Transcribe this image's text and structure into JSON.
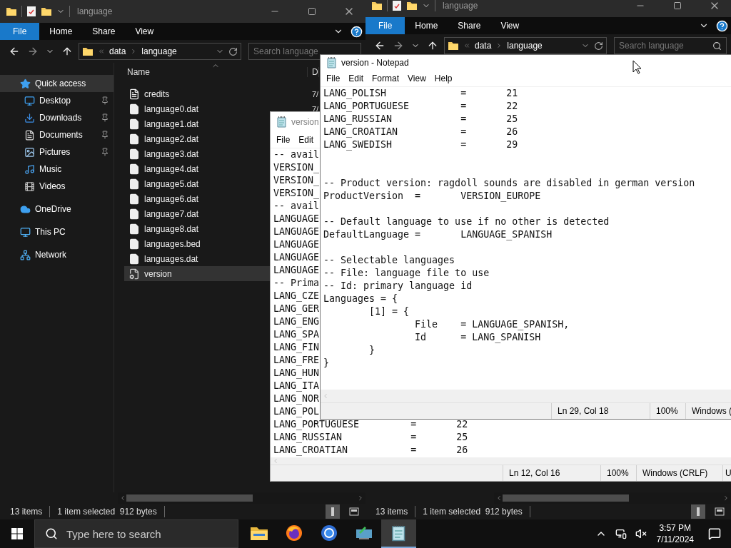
{
  "explorers": [
    {
      "title": "language",
      "ribbon_tabs": [
        {
          "label": "File",
          "selected": true
        },
        {
          "label": "Home",
          "selected": false
        },
        {
          "label": "Share",
          "selected": false
        },
        {
          "label": "View",
          "selected": false
        }
      ],
      "breadcrumb": [
        "data",
        "language"
      ],
      "search": {
        "placeholder": "Search language",
        "icon": false
      },
      "navigation": [
        {
          "label": "Quick access",
          "selected": true,
          "children": [
            {
              "label": "Desktop",
              "pinned": true,
              "selected": false
            },
            {
              "label": "Downloads",
              "pinned": true,
              "selected": false
            },
            {
              "label": "Documents",
              "pinned": true,
              "selected": false
            },
            {
              "label": "Pictures",
              "pinned": true,
              "selected": false
            },
            {
              "label": "Music",
              "pinned": false,
              "selected": false
            },
            {
              "label": "Videos",
              "pinned": false,
              "selected": false
            }
          ]
        },
        {
          "label": "OneDrive",
          "selected": false
        },
        {
          "label": "This PC",
          "selected": false
        },
        {
          "label": "Network",
          "selected": false
        }
      ],
      "columns": [
        "Name",
        "D"
      ],
      "files": [
        {
          "name": "credits",
          "kind": "text",
          "date": "7/",
          "selected": false
        },
        {
          "name": "language0.dat",
          "kind": "data",
          "date": "7/",
          "selected": false
        },
        {
          "name": "language1.dat",
          "kind": "data",
          "selected": false
        },
        {
          "name": "language2.dat",
          "kind": "data",
          "selected": false
        },
        {
          "name": "language3.dat",
          "kind": "data",
          "selected": false
        },
        {
          "name": "language4.dat",
          "kind": "data",
          "selected": false
        },
        {
          "name": "language5.dat",
          "kind": "data",
          "selected": false
        },
        {
          "name": "language6.dat",
          "kind": "data",
          "selected": false
        },
        {
          "name": "language7.dat",
          "kind": "data",
          "selected": false
        },
        {
          "name": "language8.dat",
          "kind": "data",
          "selected": false
        },
        {
          "name": "languages.bed",
          "kind": "data",
          "selected": false
        },
        {
          "name": "languages.dat",
          "kind": "data",
          "selected": false
        },
        {
          "name": "version",
          "kind": "config",
          "selected": true
        }
      ],
      "status_bar": {
        "count": "13 items",
        "selection": "1 item selected  912 bytes"
      }
    },
    {
      "title": "language",
      "ribbon_tabs": [
        {
          "label": "File",
          "selected": true
        },
        {
          "label": "Home",
          "selected": false
        },
        {
          "label": "Share",
          "selected": false
        },
        {
          "label": "View",
          "selected": false
        }
      ],
      "breadcrumb": [
        "data",
        "language"
      ],
      "search": {
        "placeholder": "Search language",
        "icon": true
      },
      "status_bar": {
        "count": "13 items",
        "selection": "1 item selected  912 bytes"
      }
    }
  ],
  "notepads": [
    {
      "title": "version",
      "active": false,
      "menu": [
        "File",
        "Edit"
      ],
      "lines": [
        {
          "text": "-- avail"
        },
        {
          "text": "VERSION_"
        },
        {
          "text": "VERSION_"
        },
        {
          "text": "VERSION_"
        },
        {
          "text": "-- avail"
        },
        {
          "text": "LANGUAGE"
        },
        {
          "text": "LANGUAGE"
        },
        {
          "text": "LANGUAGE"
        },
        {
          "text": "LANGUAGE"
        },
        {
          "text": "LANGUAGE"
        },
        {
          "text": "-- Prima"
        },
        {
          "text": "LANG_CZE"
        },
        {
          "text": "LANG_GER"
        },
        {
          "text": "LANG_ENG"
        },
        {
          "text": "LANG_SPA"
        },
        {
          "text": "LANG_FIN"
        },
        {
          "text": "LANG_FRE"
        },
        {
          "text": "LANG_HUN"
        },
        {
          "text": "LANG_ITA"
        },
        {
          "text": "LANG_NOR"
        },
        {
          "text": "LANG_POL"
        },
        {
          "text": "LANG_PORTUGUESE         =       22"
        },
        {
          "text": "LANG_RUSSIAN            =       25"
        },
        {
          "text": "LANG_CROATIAN           =       26"
        }
      ],
      "status": [
        "Ln 12, Col 16",
        "100%",
        "Windows (CRLF)",
        "U"
      ]
    },
    {
      "title": "version - Notepad",
      "active": true,
      "menu": [
        "File",
        "Edit",
        "Format",
        "View",
        "Help"
      ],
      "lines": [
        {
          "text": "LANG_POLISH             =       21"
        },
        {
          "text": "LANG_PORTUGUESE         =       22"
        },
        {
          "text": "LANG_RUSSIAN            =       25"
        },
        {
          "text": "LANG_CROATIAN           =       26"
        },
        {
          "text": "LANG_SWEDISH            =       29"
        },
        {
          "kind": "blank"
        },
        {
          "kind": "blank"
        },
        {
          "text": "-- Product version: ragdoll sounds are disabled in german version"
        },
        {
          "text": "ProductVersion  =       VERSION_EUROPE"
        },
        {
          "kind": "blank"
        },
        {
          "text": "-- Default language to use if no other is detected"
        },
        {
          "text": "DefaultLanguage =       LANGUAGE_SPANISH"
        },
        {
          "kind": "blank"
        },
        {
          "text": "-- Selectable languages"
        },
        {
          "text": "-- File: language file to use"
        },
        {
          "text": "-- Id: primary language id"
        },
        {
          "text": "Languages = {"
        },
        {
          "text": "        [1] = {"
        },
        {
          "text": "                File    = LANGUAGE_SPANISH,"
        },
        {
          "text": "                Id      = LANG_SPANISH"
        },
        {
          "text": "        }"
        },
        {
          "text": "}"
        }
      ],
      "status": [
        "Ln 29, Col 18",
        "100%",
        "Windows ("
      ]
    }
  ],
  "taskbar": {
    "search": {
      "placeholder": "Type here to search"
    },
    "apps": [
      {
        "selected": false
      },
      {
        "selected": false
      },
      {
        "selected": false
      },
      {
        "selected": false
      },
      {
        "selected": true
      }
    ],
    "time": "3:57 PM",
    "date": "7/11/2024"
  }
}
